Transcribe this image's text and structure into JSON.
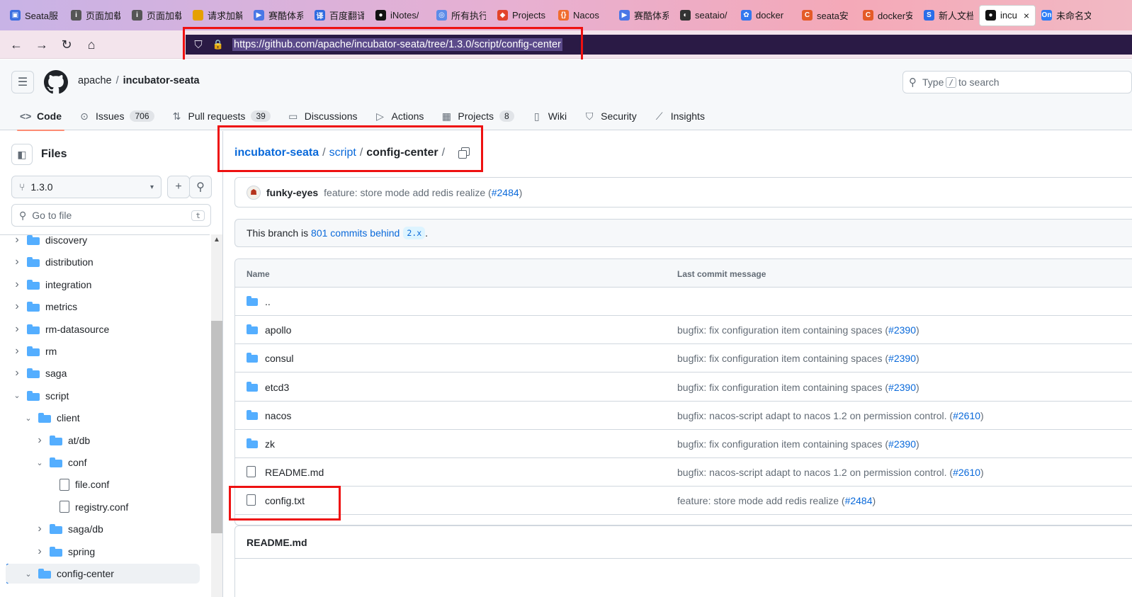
{
  "browser": {
    "tabs": [
      {
        "label": "Seata服",
        "fav": "#3b6fe0",
        "glyph": "▣"
      },
      {
        "label": "页面加载",
        "fav": "#555555",
        "glyph": "i"
      },
      {
        "label": "页面加载",
        "fav": "#555555",
        "glyph": "i"
      },
      {
        "label": "请求加解密",
        "fav": "#e5a000",
        "glyph": ""
      },
      {
        "label": "赛酷体系",
        "fav": "#4a77e6",
        "glyph": "▶"
      },
      {
        "label": "百度翻译",
        "fav": "#2f6be0",
        "glyph": "译"
      },
      {
        "label": "iNotes/",
        "fav": "#111111",
        "glyph": "●"
      },
      {
        "label": "所有执行",
        "fav": "#5c8be8",
        "glyph": "◎"
      },
      {
        "label": "Projects",
        "fav": "#e2432a",
        "glyph": "◆"
      },
      {
        "label": "Nacos",
        "fav": "#f06d2f",
        "glyph": "{}"
      },
      {
        "label": "赛酷体系",
        "fav": "#4a77e6",
        "glyph": "▶"
      },
      {
        "label": "seataio/",
        "fav": "#333333",
        "glyph": "◐"
      },
      {
        "label": "docker",
        "fav": "#3377ee",
        "glyph": "✿"
      },
      {
        "label": "seata安",
        "fav": "#e45a27",
        "glyph": "C"
      },
      {
        "label": "docker安",
        "fav": "#e45a27",
        "glyph": "C"
      },
      {
        "label": "新人文档",
        "fav": "#2a6de8",
        "glyph": "S"
      },
      {
        "label": "incub",
        "fav": "#111111",
        "glyph": "●",
        "active": true
      },
      {
        "label": "未命名文",
        "fav": "#2d7df6",
        "glyph": "On"
      }
    ],
    "close_glyph": "×",
    "back": "←",
    "forward": "→",
    "reload": "↻",
    "home": "⌂",
    "shield_icon": "⛉",
    "lock_icon": "🔒",
    "url": "https://github.com/apache/incubator-seata/tree/1.3.0/script/config-center"
  },
  "header": {
    "menu_glyph": "☰",
    "owner": "apache",
    "separator": "/",
    "repo": "incubator-seata",
    "search_icon": "⚲",
    "search_type": "Type",
    "search_key": "/",
    "search_rest": "to search"
  },
  "reponav": [
    {
      "icon": "<>",
      "label": "Code",
      "count": "",
      "selected": true
    },
    {
      "icon": "⊙",
      "label": "Issues",
      "count": "706"
    },
    {
      "icon": "⇅",
      "label": "Pull requests",
      "count": "39"
    },
    {
      "icon": "▭",
      "label": "Discussions",
      "count": ""
    },
    {
      "icon": "▷",
      "label": "Actions",
      "count": ""
    },
    {
      "icon": "▦",
      "label": "Projects",
      "count": "8"
    },
    {
      "icon": "▯",
      "label": "Wiki",
      "count": ""
    },
    {
      "icon": "⛉",
      "label": "Security",
      "count": ""
    },
    {
      "icon": "⟋",
      "label": "Insights",
      "count": ""
    }
  ],
  "sidebar": {
    "title": "Files",
    "toggle_glyph": "◧",
    "branch_glyph": "⑂",
    "branch": "1.3.0",
    "caret": "▾",
    "add_glyph": "+",
    "search_glyph": "⚲",
    "goto_placeholder": "Go to file",
    "goto_key": "t",
    "scroll_up": "▲",
    "tree": [
      {
        "label": "discovery",
        "type": "folder",
        "depth": 0,
        "open": false
      },
      {
        "label": "distribution",
        "type": "folder",
        "depth": 0,
        "open": false
      },
      {
        "label": "integration",
        "type": "folder",
        "depth": 0,
        "open": false
      },
      {
        "label": "metrics",
        "type": "folder",
        "depth": 0,
        "open": false
      },
      {
        "label": "rm-datasource",
        "type": "folder",
        "depth": 0,
        "open": false
      },
      {
        "label": "rm",
        "type": "folder",
        "depth": 0,
        "open": false
      },
      {
        "label": "saga",
        "type": "folder",
        "depth": 0,
        "open": false
      },
      {
        "label": "script",
        "type": "folder",
        "depth": 0,
        "open": true
      },
      {
        "label": "client",
        "type": "folder",
        "depth": 1,
        "open": true
      },
      {
        "label": "at/db",
        "type": "folder",
        "depth": 2,
        "open": false
      },
      {
        "label": "conf",
        "type": "folder",
        "depth": 2,
        "open": true
      },
      {
        "label": "file.conf",
        "type": "file",
        "depth": 3
      },
      {
        "label": "registry.conf",
        "type": "file",
        "depth": 3
      },
      {
        "label": "saga/db",
        "type": "folder",
        "depth": 2,
        "open": false
      },
      {
        "label": "spring",
        "type": "folder",
        "depth": 2,
        "open": false
      },
      {
        "label": "config-center",
        "type": "folder",
        "depth": 1,
        "open": true,
        "current": true
      }
    ]
  },
  "path": {
    "repo": "incubator-seata",
    "sep": "/",
    "dir": "script",
    "current": "config-center"
  },
  "latest_commit": {
    "avatar_glyph": "☗",
    "author": "funky-eyes",
    "message": "feature: store mode add redis realize (",
    "pr": "#2484",
    "close": ")"
  },
  "branch_status": {
    "prefix": "This branch is",
    "link": "801 commits behind",
    "target": "2.x",
    "suffix": "."
  },
  "files": {
    "col_name": "Name",
    "col_commit": "Last commit message",
    "rows": [
      {
        "name": "..",
        "type": "folder",
        "pre": "",
        "pr": "",
        "post": ""
      },
      {
        "name": "apollo",
        "type": "folder",
        "pre": "bugfix: fix configuration item containing spaces (",
        "pr": "#2390",
        "post": ")"
      },
      {
        "name": "consul",
        "type": "folder",
        "pre": "bugfix: fix configuration item containing spaces (",
        "pr": "#2390",
        "post": ")"
      },
      {
        "name": "etcd3",
        "type": "folder",
        "pre": "bugfix: fix configuration item containing spaces (",
        "pr": "#2390",
        "post": ")"
      },
      {
        "name": "nacos",
        "type": "folder",
        "pre": "bugfix: nacos-script adapt to nacos 1.2 on permission control. (",
        "pr": "#2610",
        "post": ")"
      },
      {
        "name": "zk",
        "type": "folder",
        "pre": "bugfix: fix configuration item containing spaces (",
        "pr": "#2390",
        "post": ")"
      },
      {
        "name": "README.md",
        "type": "file",
        "pre": "bugfix: nacos-script adapt to nacos 1.2 on permission control. (",
        "pr": "#2610",
        "post": ")"
      },
      {
        "name": "config.txt",
        "type": "file",
        "pre": "feature: store mode add redis realize (",
        "pr": "#2484",
        "post": ")"
      }
    ]
  },
  "readme": {
    "title": "README.md"
  },
  "colors": {
    "link": "#0969da",
    "folder": "#54aeff",
    "annotation": "#ee1111",
    "selected_tab": "#fd8c73"
  }
}
